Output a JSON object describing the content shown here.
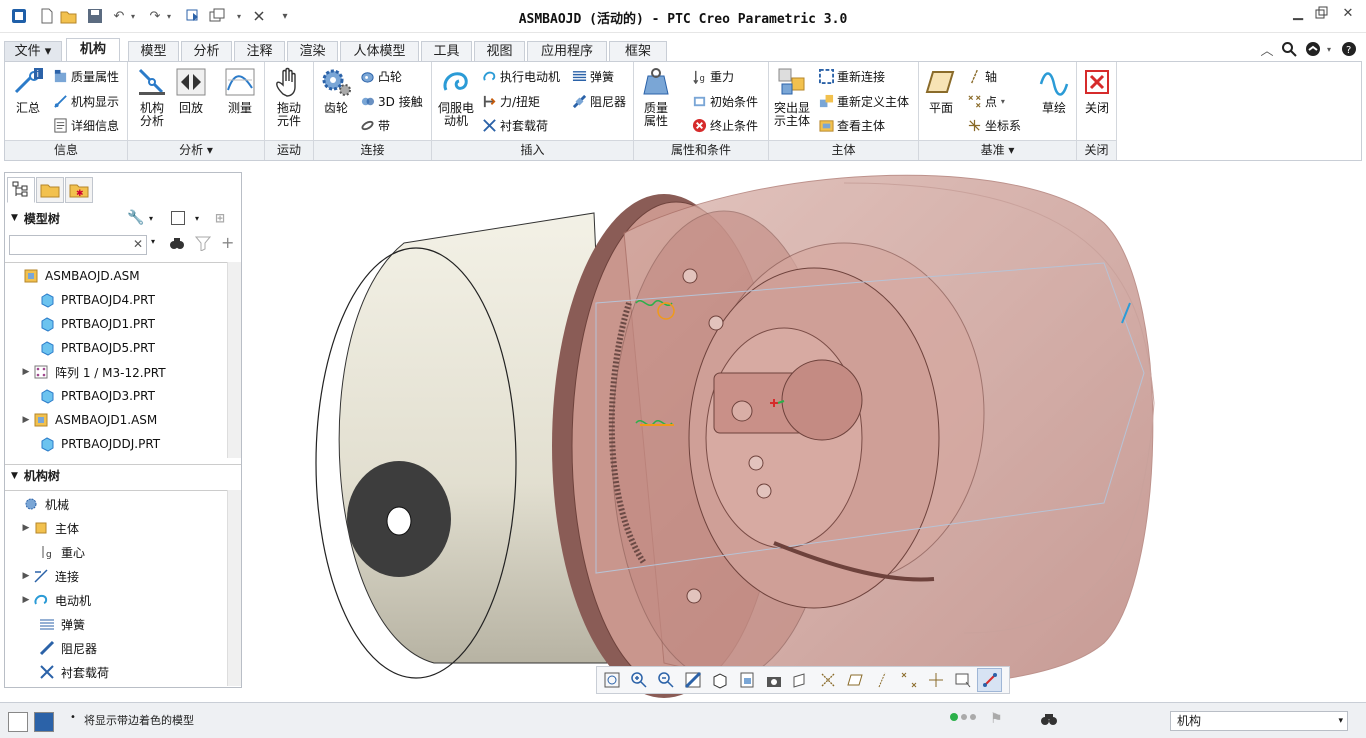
{
  "window": {
    "title": "ASMBAOJD (活动的) - PTC Creo Parametric 3.0"
  },
  "ribbon_tabs": [
    "文件",
    "机构",
    "模型",
    "分析",
    "注释",
    "渲染",
    "人体模型",
    "工具",
    "视图",
    "应用程序",
    "框架"
  ],
  "groups": {
    "info": {
      "label": "信息",
      "summary": "汇总",
      "mass_props": "质量属性",
      "mech_display": "机构显示",
      "detail_info": "详细信息"
    },
    "analysis": {
      "label": "分析",
      "mech_analysis": "机构\n分析",
      "playback": "回放",
      "measure": "测量"
    },
    "motion": {
      "label": "运动",
      "drag": "拖动\n元件"
    },
    "connect": {
      "label": "连接",
      "gear": "齿轮",
      "cam": "凸轮",
      "contact3d": "3D 接触",
      "belt": "带"
    },
    "insert": {
      "label": "插入",
      "servo": "伺服电\n动机",
      "exec_motor": "执行电动机",
      "force_torque": "力/扭矩",
      "bushing": "衬套载荷",
      "spring": "弹簧",
      "damper": "阻尼器"
    },
    "props": {
      "label": "属性和条件",
      "mass": "质量\n属性",
      "gravity": "重力",
      "init_cond": "初始条件",
      "term_cond": "终止条件"
    },
    "body": {
      "label": "主体",
      "highlight": "突出显\n示主体",
      "reconnect": "重新连接",
      "redefine": "重新定义主体",
      "view_body": "查看主体"
    },
    "datum": {
      "label": "基准",
      "plane": "平面",
      "axis": "轴",
      "point": "点",
      "csys": "坐标系",
      "sketch": "草绘"
    },
    "close": {
      "label": "关闭",
      "close": "关闭"
    }
  },
  "model_tree": {
    "header": "模型树",
    "items": [
      "ASMBAOJD.ASM",
      "PRTBAOJD4.PRT",
      "PRTBAOJD1.PRT",
      "PRTBAOJD5.PRT",
      "阵列 1 / M3-12.PRT",
      "PRTBAOJD3.PRT",
      "ASMBAOJD1.ASM",
      "PRTBAOJDDJ.PRT"
    ]
  },
  "mech_tree": {
    "header": "机构树",
    "items": [
      "机械",
      "主体",
      "重心",
      "连接",
      "电动机",
      "弹簧",
      "阻尼器",
      "衬套载荷"
    ]
  },
  "status": {
    "message": "将显示带边着色的模型",
    "filter": "机构"
  },
  "colors": {
    "accent": "#3a6fb0",
    "tab_border": "#c9ced6",
    "close_red": "#d62b2b"
  }
}
